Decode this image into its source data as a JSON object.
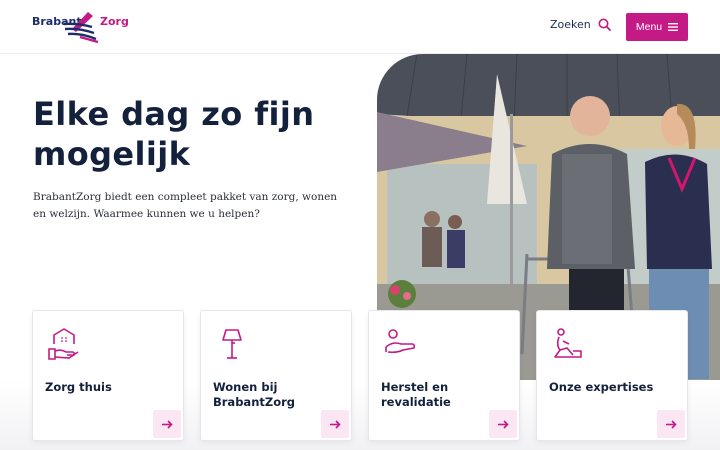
{
  "header": {
    "logo_part1": "Brabant",
    "logo_part2": "Zorg",
    "search_label": "Zoeken",
    "menu_label": "Menu"
  },
  "hero": {
    "title": "Elke dag zo fijn mogelijk",
    "text": "BrabantZorg biedt een compleet pakket van zorg, wonen en welzijn. Waarmee kunnen we u helpen?"
  },
  "cards": [
    {
      "label": "Zorg thuis",
      "icon": "home-care-icon"
    },
    {
      "label": "Wonen bij BrabantZorg",
      "icon": "floor-lamp-icon"
    },
    {
      "label": "Herstel en revalidatie",
      "icon": "rehabilitation-icon"
    },
    {
      "label": "Onze expertises",
      "icon": "expertise-icon"
    }
  ],
  "colors": {
    "accent": "#c41a86",
    "navy": "#14213d",
    "card_arrow_bg": "#fbe7f3"
  }
}
